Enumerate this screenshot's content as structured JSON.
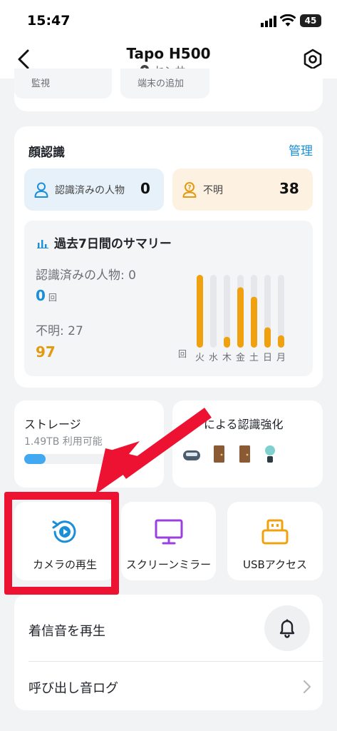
{
  "status": {
    "time": "15:47",
    "battery": "45"
  },
  "nav": {
    "title": "Tapo H500",
    "subtitle": "センサー"
  },
  "top_tiles": [
    "監視",
    "端末の追加"
  ],
  "face": {
    "title": "顔認識",
    "manage": "管理",
    "known_label": "認識済みの人物",
    "known_count": "0",
    "unknown_label": "不明",
    "unknown_count": "38",
    "summary": {
      "title": "過去7日間のサマリー",
      "known_line": "認識済みの人物: 0",
      "known_value": "0",
      "times_unit": "回",
      "unknown_line": "不明: 27",
      "unknown_value": "97",
      "axis_unit": "回"
    }
  },
  "chart_data": {
    "type": "bar",
    "categories": [
      "火",
      "水",
      "木",
      "金",
      "土",
      "日",
      "月"
    ],
    "series": [
      {
        "values": [
          100,
          0,
          15,
          83,
          70,
          28,
          17
        ]
      }
    ],
    "ylim": [
      0,
      100
    ],
    "colors": {
      "bar": "#f0a10f",
      "track": "#e6e7ea"
    }
  },
  "storage": {
    "title": "ストレージ",
    "available": "1.49TB 利用可能",
    "used_fraction": 0.2
  },
  "enhance": {
    "title": "による認識強化",
    "icons": [
      "robot-vacuum-icon",
      "door-icon",
      "door-icon",
      "plant-icon"
    ]
  },
  "actions": [
    {
      "label": "カメラの再生",
      "icon": "playback-icon"
    },
    {
      "label": "スクリーンミラー",
      "icon": "monitor-icon"
    },
    {
      "label": "USBアクセス",
      "icon": "usb-icon"
    }
  ],
  "list": {
    "ringtone": "着信音を再生",
    "call_log": "呼び出し音ログ"
  },
  "colors": {
    "accent": "#1a8fd9",
    "orange": "#f0a10f",
    "highlight": "#ee1232",
    "purple": "#9b3fe0"
  }
}
